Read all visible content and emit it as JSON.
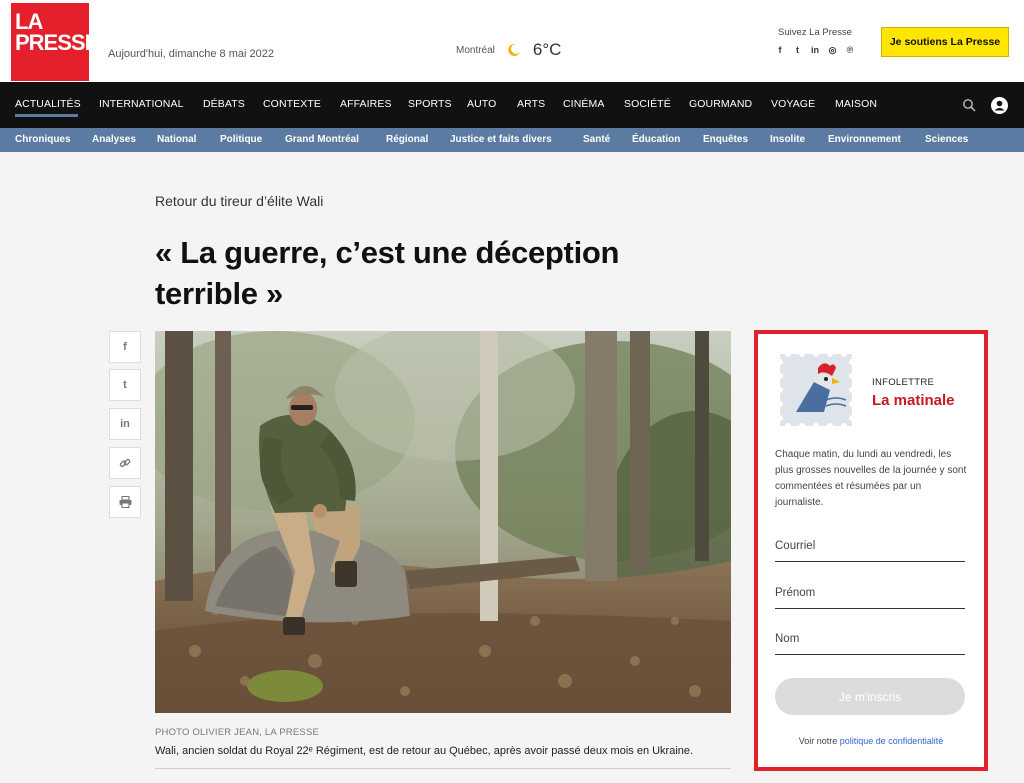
{
  "header": {
    "logo_line1": "LA",
    "logo_line2": "PRESSE",
    "date": "Aujourd'hui, dimanche 8 mai 2022",
    "weather_city": "Montréal",
    "weather_temp": "6°C",
    "follow_label": "Suivez La Presse",
    "social": [
      "f",
      "t",
      "in",
      "◎",
      "℗"
    ],
    "support_button": "Je soutiens La Presse"
  },
  "main_nav": [
    "ACTUALITÉS",
    "INTERNATIONAL",
    "DÉBATS",
    "CONTEXTE",
    "AFFAIRES",
    "SPORTS",
    "AUTO",
    "ARTS",
    "CINÉMA",
    "SOCIÉTÉ",
    "GOURMAND",
    "VOYAGE",
    "MAISON"
  ],
  "sub_nav": [
    "Chroniques",
    "Analyses",
    "National",
    "Politique",
    "Grand Montréal",
    "Régional",
    "Justice et faits divers",
    "Santé",
    "Éducation",
    "Enquêtes",
    "Insolite",
    "Environnement",
    "Sciences"
  ],
  "article": {
    "kicker": "Retour du tireur d’élite Wali",
    "headline": "« La guerre, c’est une déception terrible »",
    "photo_credit": "PHOTO OLIVIER JEAN, LA PRESSE",
    "caption": "Wali, ancien soldat du Royal 22ᵉ Régiment, est de retour au Québec, après avoir passé deux mois en Ukraine."
  },
  "share_icons": [
    "f",
    "t",
    "in",
    "🔗",
    "⎙"
  ],
  "newsletter": {
    "tag": "INFOLETTRE",
    "name": "La matinale",
    "description": "Chaque matin, du lundi au vendredi, les plus grosses nouvelles de la journée y sont commentées et résumées par un journaliste.",
    "field_email": "Courriel",
    "field_firstname": "Prénom",
    "field_lastname": "Nom",
    "submit": "Je m'inscris",
    "privacy_prefix": "Voir notre",
    "privacy_link": "politique de confidentialité"
  },
  "colors": {
    "brand_red": "#e3202b",
    "nav_black": "#111111",
    "subnav_blue": "#5b7ba3",
    "support_yellow": "#ffe500"
  }
}
